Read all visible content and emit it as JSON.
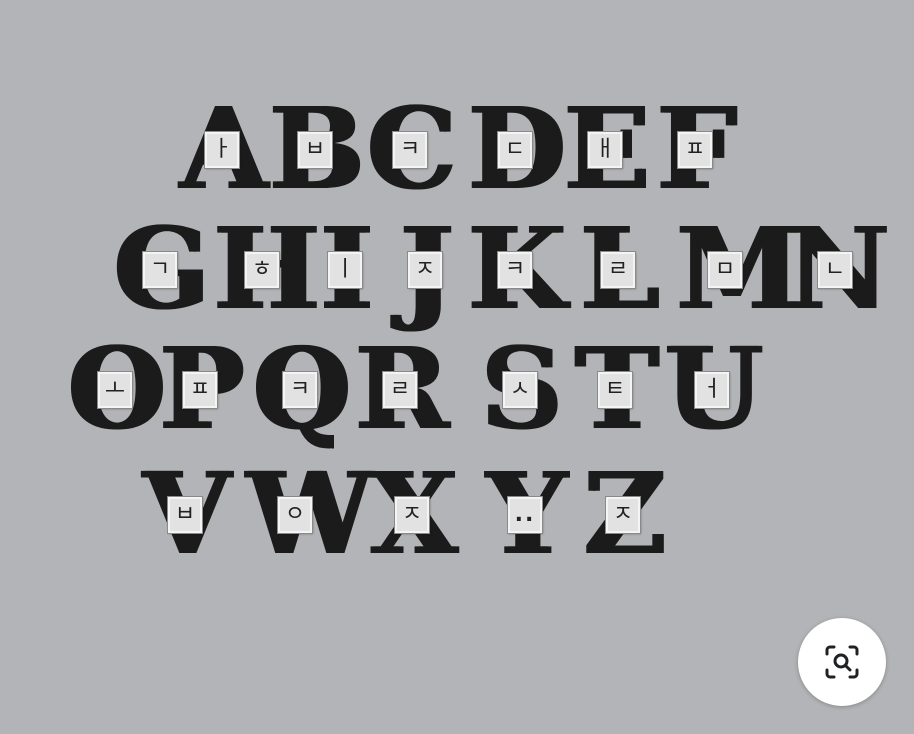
{
  "glyphs": [
    {
      "letter": "A",
      "hangul": "ㅏ"
    },
    {
      "letter": "B",
      "hangul": "ㅂ"
    },
    {
      "letter": "C",
      "hangul": "ㅋ"
    },
    {
      "letter": "D",
      "hangul": "ㄷ"
    },
    {
      "letter": "E",
      "hangul": "ㅐ"
    },
    {
      "letter": "F",
      "hangul": "ㅍ"
    },
    {
      "letter": "G",
      "hangul": "ㄱ"
    },
    {
      "letter": "H",
      "hangul": "ㅎ"
    },
    {
      "letter": "I",
      "hangul": "ㅣ"
    },
    {
      "letter": "J",
      "hangul": "ㅈ"
    },
    {
      "letter": "K",
      "hangul": "ㅋ"
    },
    {
      "letter": "L",
      "hangul": "ㄹ"
    },
    {
      "letter": "M",
      "hangul": "ㅁ"
    },
    {
      "letter": "N",
      "hangul": "ㄴ"
    },
    {
      "letter": "O",
      "hangul": "ㅗ"
    },
    {
      "letter": "P",
      "hangul": "ㅍ"
    },
    {
      "letter": "Q",
      "hangul": "ㅋ"
    },
    {
      "letter": "R",
      "hangul": "ㄹ"
    },
    {
      "letter": "S",
      "hangul": "ㅅ"
    },
    {
      "letter": "T",
      "hangul": "ㅌ"
    },
    {
      "letter": "U",
      "hangul": "ㅓ"
    },
    {
      "letter": "V",
      "hangul": "ㅂ"
    },
    {
      "letter": "W",
      "hangul": "ㅇ"
    },
    {
      "letter": "X",
      "hangul": "ㅈ"
    },
    {
      "letter": "Y",
      "hangul": ".."
    },
    {
      "letter": "Z",
      "hangul": "ㅈ"
    }
  ],
  "zoom_button": {
    "icon": "visual-search-icon"
  },
  "colors": {
    "background": "#b3b4b7",
    "letter": "#1b1b1b",
    "tile": "#e2e2e2"
  }
}
